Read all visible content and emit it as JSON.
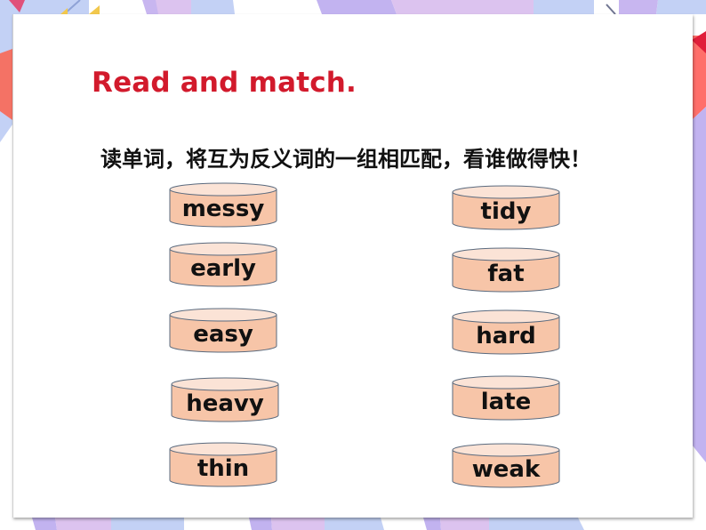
{
  "slide": {
    "title": "Read and match.",
    "instruction": "读单词，将互为反义词的一组相匹配，看谁做得快！",
    "colors": {
      "title": "#d21a2c",
      "cylinder_fill": "#f7c5a8",
      "cylinder_top": "#fbe3d6",
      "cylinder_stroke": "#5a6a7e"
    }
  },
  "left_words": [
    "messy",
    "early",
    "easy",
    "heavy",
    "thin"
  ],
  "right_words": [
    "tidy",
    "fat",
    "hard",
    "late",
    "weak"
  ]
}
